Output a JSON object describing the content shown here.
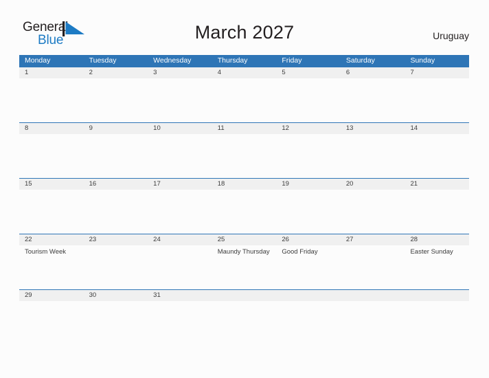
{
  "brand": {
    "name_part1": "General",
    "name_part2": "Blue",
    "mark": "triangle-flag-icon",
    "color_dark": "#231f20",
    "color_blue": "#1d7bc4"
  },
  "header": {
    "title": "March 2027",
    "country": "Uruguay"
  },
  "theme": {
    "header_blue": "#2e75b6",
    "date_band": "#f0f0f0",
    "page_background": "#fcfcfc",
    "text": "#3b3b3b"
  },
  "calendar": {
    "month": "March",
    "year": "2027",
    "weekday_headers": [
      "Monday",
      "Tuesday",
      "Wednesday",
      "Thursday",
      "Friday",
      "Saturday",
      "Sunday"
    ],
    "weeks": [
      {
        "days": [
          "1",
          "2",
          "3",
          "4",
          "5",
          "6",
          "7"
        ],
        "events": [
          "",
          "",
          "",
          "",
          "",
          "",
          ""
        ]
      },
      {
        "days": [
          "8",
          "9",
          "10",
          "11",
          "12",
          "13",
          "14"
        ],
        "events": [
          "",
          "",
          "",
          "",
          "",
          "",
          ""
        ]
      },
      {
        "days": [
          "15",
          "16",
          "17",
          "18",
          "19",
          "20",
          "21"
        ],
        "events": [
          "",
          "",
          "",
          "",
          "",
          "",
          ""
        ]
      },
      {
        "days": [
          "22",
          "23",
          "24",
          "25",
          "26",
          "27",
          "28"
        ],
        "events": [
          "Tourism Week",
          "",
          "",
          "Maundy Thursday",
          "Good Friday",
          "",
          "Easter Sunday"
        ]
      },
      {
        "days": [
          "29",
          "30",
          "31",
          "",
          "",
          "",
          ""
        ],
        "events": [
          "",
          "",
          "",
          "",
          "",
          "",
          ""
        ]
      }
    ]
  }
}
